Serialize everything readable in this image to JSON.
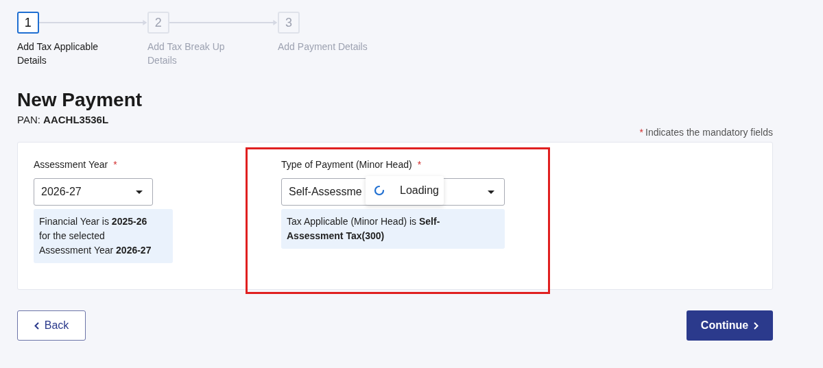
{
  "stepper": [
    {
      "number": "1",
      "label": "Add Tax Applicable Details",
      "selected": true
    },
    {
      "number": "2",
      "label": "Add Tax Break Up Details",
      "selected": false
    },
    {
      "number": "3",
      "label": "Add Payment Details",
      "selected": false
    }
  ],
  "title": "New Payment",
  "pan": {
    "label": "PAN:",
    "value": "AACHL3536L"
  },
  "mandatory_note": {
    "mark": "*",
    "text": "Indicates the mandatory fields"
  },
  "fields": [
    {
      "label": "Assessment Year",
      "required_mark": "*",
      "value": "2026-27",
      "info": "Financial Year is **2025-26** for the selected Assessment Year **2026-27**",
      "loading": false
    },
    {
      "label": "Type of Payment (Minor Head)",
      "required_mark": "*",
      "value": "Self-Assessme",
      "info": "Tax Applicable (Minor Head) is **Self-Assessment Tax(300)**",
      "loading": true,
      "loading_text": "Loading",
      "highlighted": true
    }
  ],
  "buttons": {
    "back": "Back",
    "continue": "Continue"
  }
}
